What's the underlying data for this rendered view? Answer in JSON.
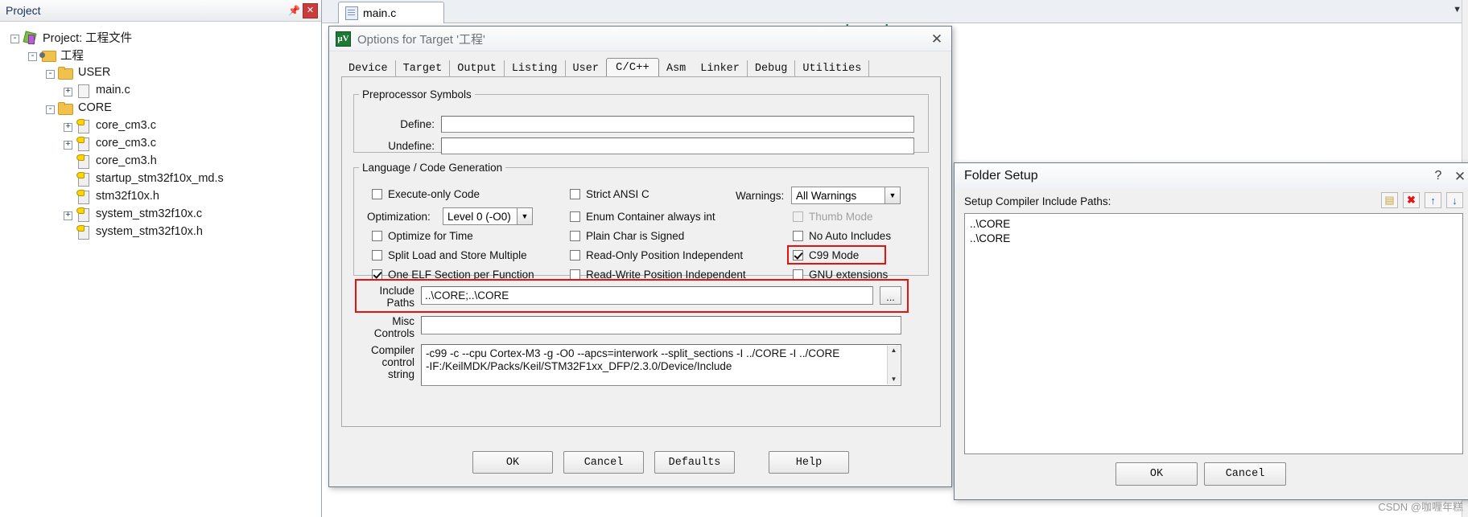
{
  "project_panel": {
    "title": "Project",
    "pin_icon": "pin-icon",
    "close_icon": "close-icon",
    "tree": [
      {
        "indent": 1,
        "expander": "-",
        "icon": "project-icon",
        "label": "Project: 工程文件"
      },
      {
        "indent": 2,
        "expander": "-",
        "icon": "target-icon",
        "label": "工程"
      },
      {
        "indent": 3,
        "expander": "-",
        "icon": "folder-icon",
        "label": "USER"
      },
      {
        "indent": 4,
        "expander": "+",
        "icon": "file-icon",
        "label": "main.c"
      },
      {
        "indent": 3,
        "expander": "-",
        "icon": "folder-icon",
        "label": "CORE"
      },
      {
        "indent": 4,
        "expander": "+",
        "icon": "source-icon",
        "label": "core_cm3.c"
      },
      {
        "indent": 4,
        "expander": "+",
        "icon": "source-icon",
        "label": "core_cm3.c"
      },
      {
        "indent": 4,
        "expander": "",
        "icon": "source-icon",
        "label": "core_cm3.h"
      },
      {
        "indent": 4,
        "expander": "",
        "icon": "source-icon",
        "label": "startup_stm32f10x_md.s"
      },
      {
        "indent": 4,
        "expander": "",
        "icon": "source-icon",
        "label": "stm32f10x.h"
      },
      {
        "indent": 4,
        "expander": "+",
        "icon": "source-icon",
        "label": "system_stm32f10x.c"
      },
      {
        "indent": 4,
        "expander": "",
        "icon": "source-icon",
        "label": "system_stm32f10x.h"
      }
    ]
  },
  "editor": {
    "tab_label": "main.c",
    "tab_icon": "document-icon",
    "scroll_icon": "chevron-down-icon",
    "code_text": "e header"
  },
  "options_dialog": {
    "title": "Options for Target '工程'",
    "app_icon": "keil-uvision-icon",
    "close_icon": "close-icon",
    "tabs": [
      {
        "label": "Device",
        "selected": false
      },
      {
        "label": "Target",
        "selected": false
      },
      {
        "label": "Output",
        "selected": false
      },
      {
        "label": "Listing",
        "selected": false
      },
      {
        "label": "User",
        "selected": false
      },
      {
        "label": "C/C++",
        "selected": true
      },
      {
        "label": "Asm",
        "selected": false
      },
      {
        "label": "Linker",
        "selected": false
      },
      {
        "label": "Debug",
        "selected": false
      },
      {
        "label": "Utilities",
        "selected": false
      }
    ],
    "preprocessor": {
      "legend": "Preprocessor Symbols",
      "define_label": "Define:",
      "define_value": "",
      "undefine_label": "Undefine:",
      "undefine_value": ""
    },
    "language": {
      "legend": "Language / Code Generation",
      "left_checks": [
        {
          "label": "Execute-only Code",
          "checked": false,
          "disabled": false
        },
        {
          "label": "Optimize for Time",
          "checked": false,
          "disabled": false
        },
        {
          "label": "Split Load and Store Multiple",
          "checked": false,
          "disabled": false
        },
        {
          "label": "One ELF Section per Function",
          "checked": true,
          "disabled": false
        }
      ],
      "optimization_label": "Optimization:",
      "optimization_value": "Level 0 (-O0)",
      "middle_checks": [
        {
          "label": "Strict ANSI C",
          "checked": false,
          "disabled": false
        },
        {
          "label": "Enum Container always int",
          "checked": false,
          "disabled": false
        },
        {
          "label": "Plain Char is Signed",
          "checked": false,
          "disabled": false
        },
        {
          "label": "Read-Only Position Independent",
          "checked": false,
          "disabled": false
        },
        {
          "label": "Read-Write Position Independent",
          "checked": false,
          "disabled": false
        }
      ],
      "warnings_label": "Warnings:",
      "warnings_value": "All Warnings",
      "right_checks": [
        {
          "label": "Thumb Mode",
          "checked": false,
          "disabled": true
        },
        {
          "label": "No Auto Includes",
          "checked": false,
          "disabled": false
        },
        {
          "label": "C99 Mode",
          "checked": true,
          "disabled": false,
          "highlighted": true
        },
        {
          "label": "GNU extensions",
          "checked": false,
          "disabled": false
        }
      ]
    },
    "include_paths_label_line1": "Include",
    "include_paths_label_line2": "Paths",
    "include_paths_value": "..\\CORE;..\\CORE",
    "include_browse_label": "...",
    "misc_label_line1": "Misc",
    "misc_label_line2": "Controls",
    "misc_value": "",
    "compiler_label_line1": "Compiler",
    "compiler_label_line2": "control",
    "compiler_label_line3": "string",
    "compiler_value_line1": "-c99 -c --cpu Cortex-M3 -g -O0 --apcs=interwork --split_sections -I ../CORE -I ../CORE",
    "compiler_value_line2": "-IF:/KeilMDK/Packs/Keil/STM32F1xx_DFP/2.3.0/Device/Include",
    "buttons": [
      {
        "label": "OK"
      },
      {
        "label": "Cancel"
      },
      {
        "label": "Defaults"
      },
      {
        "label": "Help"
      }
    ]
  },
  "folder_dialog": {
    "title": "Folder Setup",
    "help_icon": "question-mark-icon",
    "close_icon": "close-icon",
    "list_label": "Setup Compiler Include Paths:",
    "toolbar": [
      {
        "name": "new-path-icon",
        "glyph": "▤"
      },
      {
        "name": "delete-path-icon",
        "glyph": "✖"
      },
      {
        "name": "move-up-icon",
        "glyph": "↑"
      },
      {
        "name": "move-down-icon",
        "glyph": "↓"
      }
    ],
    "paths": [
      "..\\CORE",
      "..\\CORE"
    ],
    "buttons": [
      {
        "label": "OK"
      },
      {
        "label": "Cancel"
      }
    ]
  },
  "watermark": "CSDN @咖喱年糕",
  "colors": {
    "highlight_red": "#e8110f",
    "code_green": "#1f7a3f",
    "title_blue": "#16325c"
  }
}
